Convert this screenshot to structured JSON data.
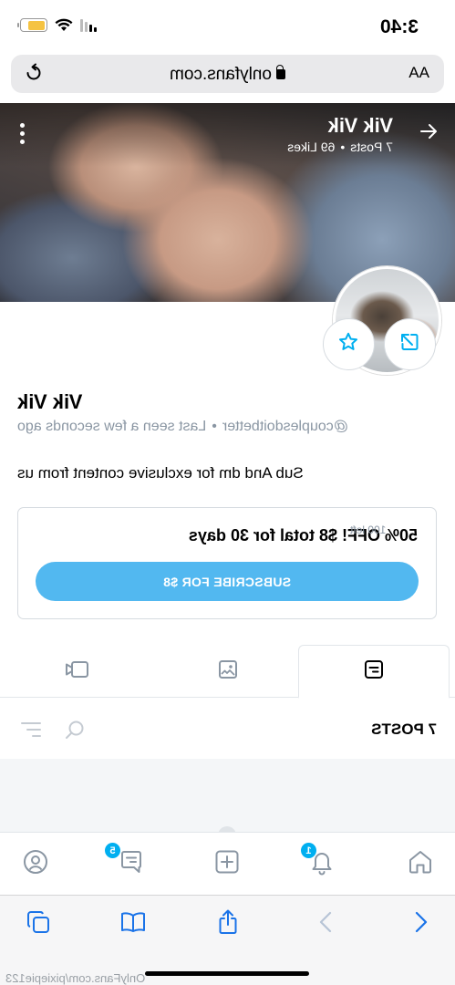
{
  "status_bar": {
    "time": "3:40"
  },
  "browser": {
    "text_size_label": "AA",
    "url": "onlyfans.com",
    "footer_url": "OnlyFans.com/pixiepie123"
  },
  "profile": {
    "name": "Vik Vik",
    "posts_stat": "7 Posts",
    "likes_stat": "69 Likes",
    "handle": "@couplesdoitbetter",
    "last_seen": "Last seen a few seconds ago",
    "bio": "Sub And dm for exclusive content from us"
  },
  "subscription": {
    "offer": "50% OFF! $8 total for 30 days",
    "remaining": "100 left",
    "button_label": "SUBSCRIBE FOR $8"
  },
  "posts_bar": {
    "count_label": "7 POSTS"
  },
  "app_nav": {
    "messages_badge": "5",
    "notifications_badge": "1"
  },
  "colors": {
    "accent": "#00aff0",
    "subscribe_button": "#52b8f0",
    "secondary_text": "#8a96a3",
    "icon": "#8a96a3",
    "safari_blue": "#1a73e8"
  },
  "icons": {
    "status": [
      "signal-icon",
      "wifi-icon",
      "battery-icon"
    ],
    "browser": [
      "reload-icon",
      "lock-icon"
    ],
    "cover": [
      "back-arrow-icon",
      "more-vertical-icon"
    ],
    "actions": [
      "star-icon",
      "share-icon"
    ],
    "tabs": [
      "posts-icon",
      "photos-icon",
      "videos-icon"
    ],
    "posts_bar": [
      "search-icon",
      "filter-icon"
    ],
    "app_nav": [
      "home-icon",
      "bell-icon",
      "plus-square-icon",
      "messages-icon",
      "profile-icon"
    ],
    "safari": [
      "back-icon",
      "forward-icon",
      "share-icon",
      "bookmarks-icon",
      "tabs-icon"
    ]
  }
}
